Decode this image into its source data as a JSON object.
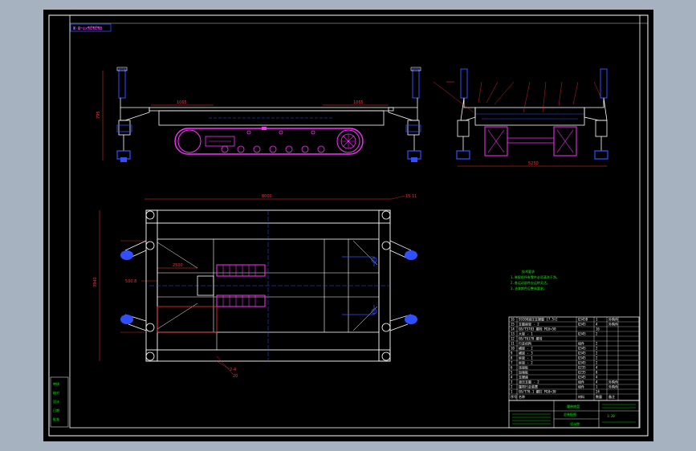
{
  "header_tag": "Ж·Ш¬іх¶Ё¶Ё¶В",
  "dims": {
    "side_left": "1065",
    "side_right": "1065",
    "side_height": "795",
    "end_width": "5250",
    "plan_width": "8000",
    "plan_height": "3940",
    "plan_inner": "2500",
    "left_callout": "530.8",
    "top_right_callout": "15 11"
  },
  "bottom_callouts": [
    "2-4",
    "20"
  ],
  "notes": [
    "技术要求",
    "1.装配前所有零件必须清洗干净。",
    "2.各运动部件应运转灵活。",
    "3.油漆颜色见整体要求。"
  ],
  "bom_rows": [
    {
      "no": "16",
      "name": "S9200液压支撑腿 [7.5t]",
      "code": "Q345B",
      "qty": "1",
      "remark": "外购件"
    },
    {
      "no": "15",
      "name": "支腿座架 - 2",
      "code": "Q345",
      "qty": "4",
      "remark": "外购件"
    },
    {
      "no": "14",
      "name": "GB/T5783 螺栓 M16×50",
      "code": "",
      "qty": "16",
      "remark": ""
    },
    {
      "no": "13",
      "name": "大梁 - 1",
      "code": "Q345",
      "qty": "2",
      "remark": ""
    },
    {
      "no": "12",
      "name": "GB/T6170 螺母",
      "code": "",
      "qty": "",
      "remark": ""
    },
    {
      "no": "11",
      "name": "行走机构",
      "code": "组件",
      "qty": "2",
      "remark": ""
    },
    {
      "no": "10",
      "name": "横梁 - 2",
      "code": "Q345",
      "qty": "2",
      "remark": ""
    },
    {
      "no": "9",
      "name": "横梁 - 3",
      "code": "Q345",
      "qty": "2",
      "remark": ""
    },
    {
      "no": "8",
      "name": "纵梁 - 1",
      "code": "Q345",
      "qty": "2",
      "remark": ""
    },
    {
      "no": "7",
      "name": "纵梁 - 2",
      "code": "Q345",
      "qty": "2",
      "remark": ""
    },
    {
      "no": "6",
      "name": "连接板",
      "code": "Q235",
      "qty": "4",
      "remark": ""
    },
    {
      "no": "5",
      "name": "加强板",
      "code": "Q235",
      "qty": "8",
      "remark": ""
    },
    {
      "no": "4",
      "name": "支撑座",
      "code": "Q345",
      "qty": "4",
      "remark": ""
    },
    {
      "no": "3",
      "name": "液压支腿 - 2",
      "code": "组件",
      "qty": "4",
      "remark": "外购件"
    },
    {
      "no": "2",
      "name": "履带行走装置",
      "code": "组件",
      "qty": "1",
      "remark": "外购件"
    },
    {
      "no": "1",
      "name": "GB/T70.1 螺钉 M10×30",
      "code": "",
      "qty": "24",
      "remark": ""
    }
  ],
  "bom_header": {
    "no": "序号",
    "name": "名称",
    "code": "材料",
    "qty": "数量",
    "remark": "备注"
  },
  "title_block": {
    "title": "履带底盘",
    "subtitle": "总装配图",
    "company": "设计院",
    "scale": "1:20"
  },
  "left_strip": [
    "审核",
    "校对",
    "设计",
    "日期",
    "批准"
  ]
}
